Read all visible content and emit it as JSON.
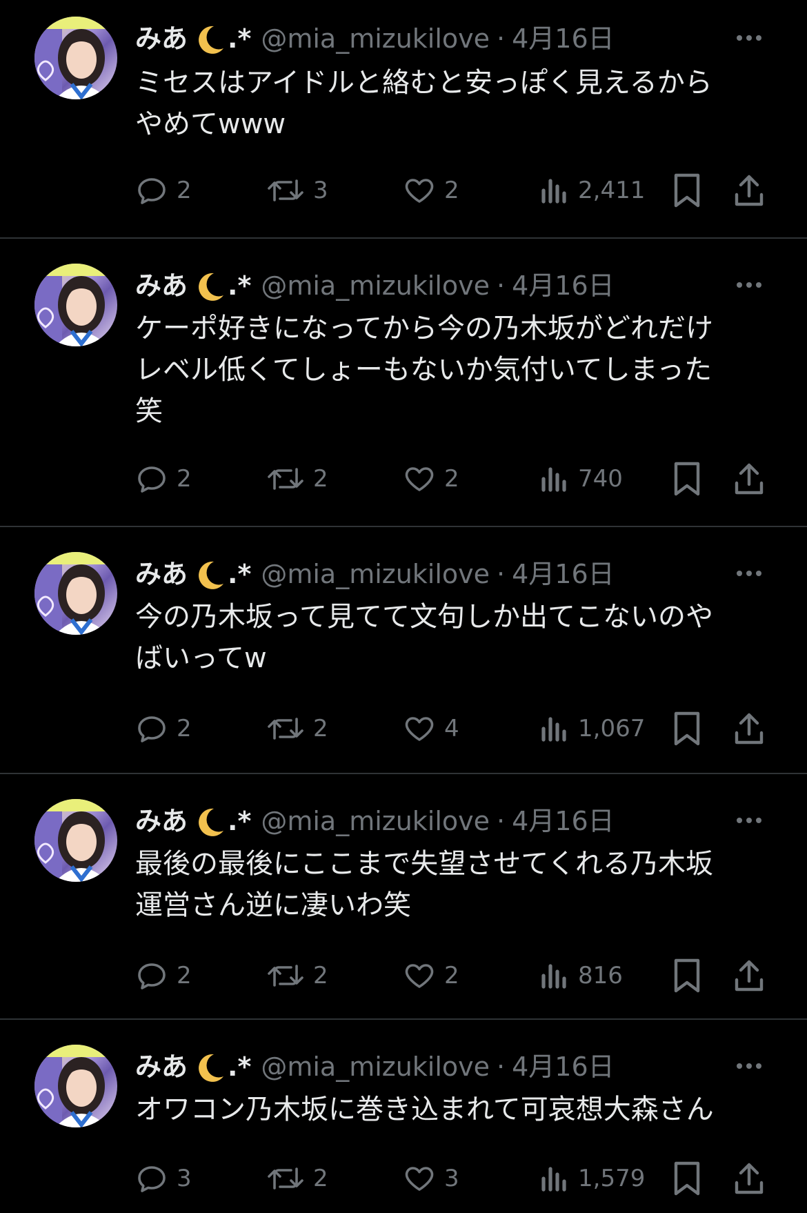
{
  "colors": {
    "background": "#000000",
    "text": "#e7e9ea",
    "muted": "#71767b",
    "divider": "#2f3336",
    "moon": "#f2c14e"
  },
  "tweets": [
    {
      "display_name": "みあ",
      "star": ".*",
      "handle": "@mia_mizukilove",
      "dot": "·",
      "date": "4月16日",
      "text": "ミセスはアイドルと絡むと安っぽく見えるから\nやめてwww",
      "replies": "2",
      "retweets": "3",
      "likes": "2",
      "views": "2,411"
    },
    {
      "display_name": "みあ",
      "star": ".*",
      "handle": "@mia_mizukilove",
      "dot": "·",
      "date": "4月16日",
      "text": "ケーポ好きになってから今の乃木坂がどれだけ\nレベル低くてしょーもないか気付いてしまった\n笑",
      "replies": "2",
      "retweets": "2",
      "likes": "2",
      "views": "740"
    },
    {
      "display_name": "みあ",
      "star": ".*",
      "handle": "@mia_mizukilove",
      "dot": "·",
      "date": "4月16日",
      "text": "今の乃木坂って見てて文句しか出てこないのや\nばいってw",
      "replies": "2",
      "retweets": "2",
      "likes": "4",
      "views": "1,067"
    },
    {
      "display_name": "みあ",
      "star": ".*",
      "handle": "@mia_mizukilove",
      "dot": "·",
      "date": "4月16日",
      "text": "最後の最後にここまで失望させてくれる乃木坂\n運営さん逆に凄いわ笑",
      "replies": "2",
      "retweets": "2",
      "likes": "2",
      "views": "816"
    },
    {
      "display_name": "みあ",
      "star": ".*",
      "handle": "@mia_mizukilove",
      "dot": "·",
      "date": "4月16日",
      "text": "オワコン乃木坂に巻き込まれて可哀想大森さん",
      "replies": "3",
      "retweets": "2",
      "likes": "3",
      "views": "1,579"
    }
  ]
}
